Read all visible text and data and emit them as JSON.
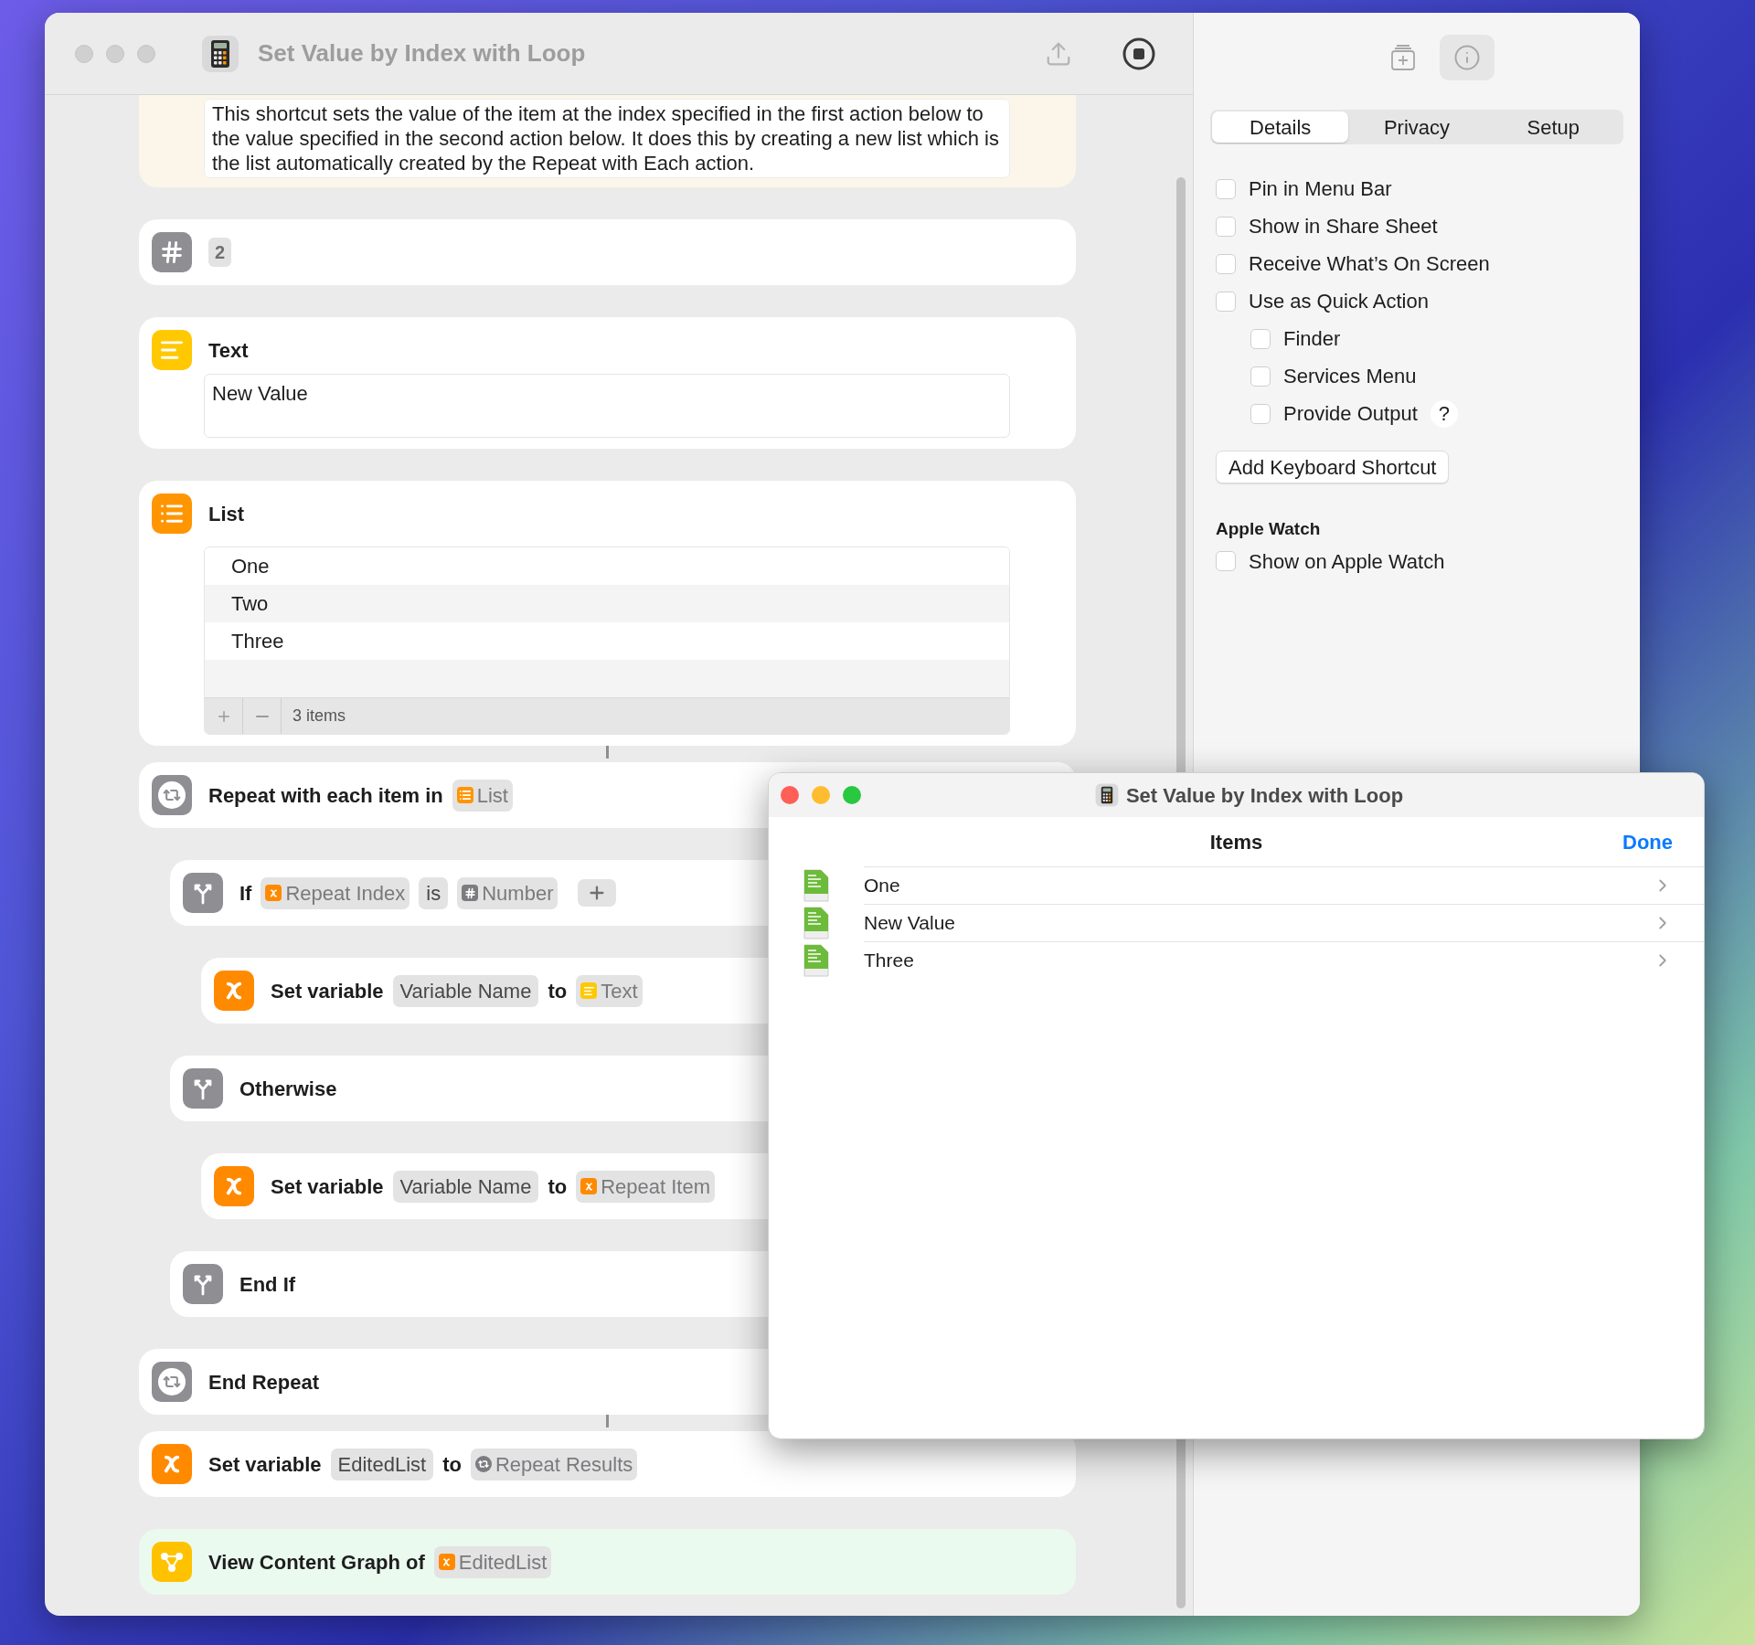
{
  "window": {
    "title": "Set Value by Index with Loop"
  },
  "description": "This shortcut sets the value of the item at the index specified in the first action below to the value specified in the second action below. It does this by creating a new list which is the list automatically created by the Repeat with Each action.",
  "actions": [
    {
      "kind": "number",
      "parts": [
        {
          "kind": "value",
          "text": "2"
        }
      ]
    },
    {
      "kind": "text",
      "title": "Text",
      "value": "New Value"
    },
    {
      "kind": "list",
      "title": "List",
      "items": [
        "One",
        "Two",
        "Three"
      ],
      "count": "3 items"
    },
    {
      "kind": "repeat",
      "parts": [
        {
          "kind": "label",
          "text": "Repeat with each item in"
        },
        {
          "kind": "list",
          "text": "List"
        }
      ],
      "children": [
        {
          "kind": "branch",
          "parts": [
            {
              "kind": "label",
              "text": "If"
            },
            {
              "kind": "variable",
              "text": "Repeat Index"
            },
            {
              "kind": "plain",
              "text": "is"
            },
            {
              "kind": "number",
              "text": "Number"
            },
            {
              "kind": "add"
            }
          ],
          "children": [
            {
              "kind": "set_variable",
              "parts": [
                {
                  "kind": "label",
                  "text": "Set variable"
                },
                {
                  "kind": "plain",
                  "text": "Variable Name"
                },
                {
                  "kind": "label",
                  "text": "to"
                },
                {
                  "kind": "text",
                  "text": "Text"
                }
              ]
            }
          ]
        },
        {
          "kind": "branch",
          "parts": [
            {
              "kind": "label",
              "text": "Otherwise"
            }
          ],
          "children": [
            {
              "kind": "set_variable",
              "parts": [
                {
                  "kind": "label",
                  "text": "Set variable"
                },
                {
                  "kind": "plain",
                  "text": "Variable Name"
                },
                {
                  "kind": "label",
                  "text": "to"
                },
                {
                  "kind": "variable",
                  "text": "Repeat Item"
                }
              ]
            }
          ]
        },
        {
          "kind": "branch",
          "parts": [
            {
              "kind": "label",
              "text": "End If"
            }
          ]
        }
      ]
    },
    {
      "kind": "repeat",
      "parts": [
        {
          "kind": "label",
          "text": "End Repeat"
        }
      ]
    },
    {
      "kind": "set_variable",
      "parts": [
        {
          "kind": "label",
          "text": "Set variable"
        },
        {
          "kind": "plain",
          "text": "EditedList"
        },
        {
          "kind": "label",
          "text": "to"
        },
        {
          "kind": "repeat",
          "text": "Repeat Results"
        }
      ]
    },
    {
      "kind": "view_graph",
      "parts": [
        {
          "kind": "label",
          "text": "View Content Graph of"
        },
        {
          "kind": "variable",
          "text": "EditedList"
        }
      ]
    }
  ],
  "sidebar": {
    "tool_buttons": [
      {
        "kind": "add",
        "selected": false
      },
      {
        "kind": "info",
        "selected": true
      }
    ],
    "tabs": [
      {
        "label": "Details",
        "selected": true
      },
      {
        "label": "Privacy",
        "selected": false
      },
      {
        "label": "Setup",
        "selected": false
      }
    ],
    "options": [
      {
        "label": "Pin in Menu Bar",
        "checked": false
      },
      {
        "label": "Show in Share Sheet",
        "checked": false
      },
      {
        "label": "Receive What’s On Screen",
        "checked": false
      },
      {
        "label": "Use as Quick Action",
        "checked": false,
        "children": [
          {
            "label": "Finder",
            "checked": false
          },
          {
            "label": "Services Menu",
            "checked": false
          },
          {
            "label": "Provide Output",
            "checked": false,
            "help": "?"
          }
        ]
      }
    ],
    "shortcut_button": "Add Keyboard Shortcut",
    "sections": [
      {
        "title": "Apple Watch",
        "options": [
          {
            "label": "Show on Apple Watch",
            "checked": false
          }
        ]
      }
    ]
  },
  "popup": {
    "title": "Set Value by Index with Loop",
    "heading": "Items",
    "done": "Done",
    "items": [
      "One",
      "New Value",
      "Three"
    ]
  }
}
